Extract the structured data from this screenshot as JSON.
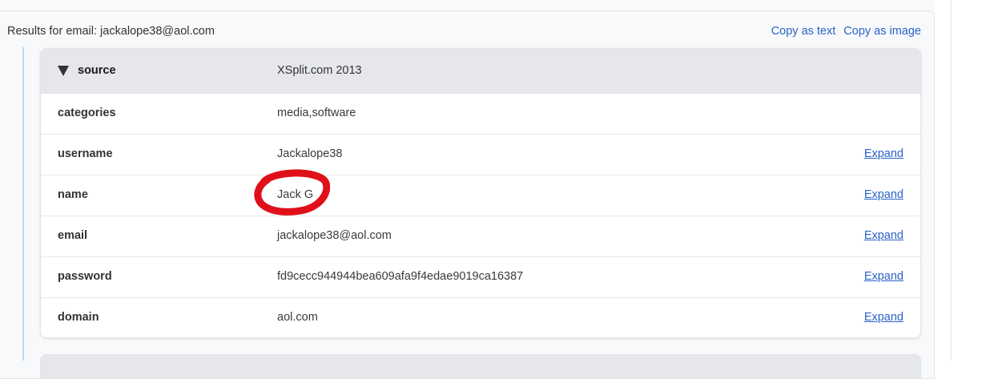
{
  "results": {
    "title": "Results for email: jackalope38@aol.com",
    "copy_text": "Copy as text",
    "copy_image": "Copy as image"
  },
  "record": {
    "header": {
      "key": "source",
      "value": "XSplit.com 2013"
    },
    "rows": [
      {
        "key": "categories",
        "value": "media,software",
        "expand": ""
      },
      {
        "key": "username",
        "value": "Jackalope38",
        "expand": "Expand"
      },
      {
        "key": "name",
        "value": "Jack G",
        "expand": "Expand"
      },
      {
        "key": "email",
        "value": "jackalope38@aol.com",
        "expand": "Expand"
      },
      {
        "key": "password",
        "value": "fd9cecc944944bea609afa9f4edae9019ca16387",
        "expand": "Expand"
      },
      {
        "key": "domain",
        "value": "aol.com",
        "expand": "Expand"
      }
    ]
  },
  "colors": {
    "link": "#2a62c9",
    "header_bg": "#e5e7eb",
    "tree_line": "#bcd6f7",
    "annotation": "#e0101a"
  },
  "icons": {
    "caret": "caret-down-icon"
  }
}
